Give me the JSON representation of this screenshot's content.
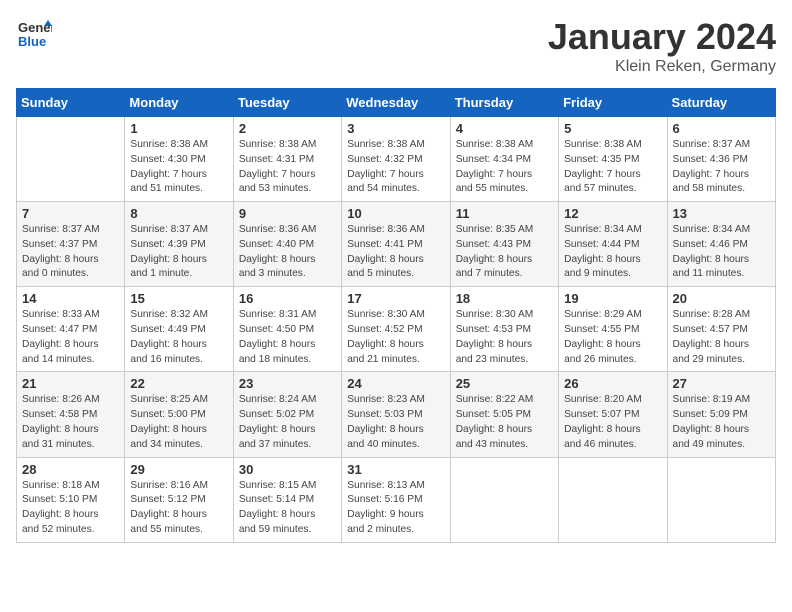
{
  "header": {
    "logo_line1": "General",
    "logo_line2": "Blue",
    "title": "January 2024",
    "subtitle": "Klein Reken, Germany"
  },
  "weekdays": [
    "Sunday",
    "Monday",
    "Tuesday",
    "Wednesday",
    "Thursday",
    "Friday",
    "Saturday"
  ],
  "weeks": [
    [
      {
        "day": "",
        "info": ""
      },
      {
        "day": "1",
        "info": "Sunrise: 8:38 AM\nSunset: 4:30 PM\nDaylight: 7 hours\nand 51 minutes."
      },
      {
        "day": "2",
        "info": "Sunrise: 8:38 AM\nSunset: 4:31 PM\nDaylight: 7 hours\nand 53 minutes."
      },
      {
        "day": "3",
        "info": "Sunrise: 8:38 AM\nSunset: 4:32 PM\nDaylight: 7 hours\nand 54 minutes."
      },
      {
        "day": "4",
        "info": "Sunrise: 8:38 AM\nSunset: 4:34 PM\nDaylight: 7 hours\nand 55 minutes."
      },
      {
        "day": "5",
        "info": "Sunrise: 8:38 AM\nSunset: 4:35 PM\nDaylight: 7 hours\nand 57 minutes."
      },
      {
        "day": "6",
        "info": "Sunrise: 8:37 AM\nSunset: 4:36 PM\nDaylight: 7 hours\nand 58 minutes."
      }
    ],
    [
      {
        "day": "7",
        "info": "Sunrise: 8:37 AM\nSunset: 4:37 PM\nDaylight: 8 hours\nand 0 minutes."
      },
      {
        "day": "8",
        "info": "Sunrise: 8:37 AM\nSunset: 4:39 PM\nDaylight: 8 hours\nand 1 minute."
      },
      {
        "day": "9",
        "info": "Sunrise: 8:36 AM\nSunset: 4:40 PM\nDaylight: 8 hours\nand 3 minutes."
      },
      {
        "day": "10",
        "info": "Sunrise: 8:36 AM\nSunset: 4:41 PM\nDaylight: 8 hours\nand 5 minutes."
      },
      {
        "day": "11",
        "info": "Sunrise: 8:35 AM\nSunset: 4:43 PM\nDaylight: 8 hours\nand 7 minutes."
      },
      {
        "day": "12",
        "info": "Sunrise: 8:34 AM\nSunset: 4:44 PM\nDaylight: 8 hours\nand 9 minutes."
      },
      {
        "day": "13",
        "info": "Sunrise: 8:34 AM\nSunset: 4:46 PM\nDaylight: 8 hours\nand 11 minutes."
      }
    ],
    [
      {
        "day": "14",
        "info": "Sunrise: 8:33 AM\nSunset: 4:47 PM\nDaylight: 8 hours\nand 14 minutes."
      },
      {
        "day": "15",
        "info": "Sunrise: 8:32 AM\nSunset: 4:49 PM\nDaylight: 8 hours\nand 16 minutes."
      },
      {
        "day": "16",
        "info": "Sunrise: 8:31 AM\nSunset: 4:50 PM\nDaylight: 8 hours\nand 18 minutes."
      },
      {
        "day": "17",
        "info": "Sunrise: 8:30 AM\nSunset: 4:52 PM\nDaylight: 8 hours\nand 21 minutes."
      },
      {
        "day": "18",
        "info": "Sunrise: 8:30 AM\nSunset: 4:53 PM\nDaylight: 8 hours\nand 23 minutes."
      },
      {
        "day": "19",
        "info": "Sunrise: 8:29 AM\nSunset: 4:55 PM\nDaylight: 8 hours\nand 26 minutes."
      },
      {
        "day": "20",
        "info": "Sunrise: 8:28 AM\nSunset: 4:57 PM\nDaylight: 8 hours\nand 29 minutes."
      }
    ],
    [
      {
        "day": "21",
        "info": "Sunrise: 8:26 AM\nSunset: 4:58 PM\nDaylight: 8 hours\nand 31 minutes."
      },
      {
        "day": "22",
        "info": "Sunrise: 8:25 AM\nSunset: 5:00 PM\nDaylight: 8 hours\nand 34 minutes."
      },
      {
        "day": "23",
        "info": "Sunrise: 8:24 AM\nSunset: 5:02 PM\nDaylight: 8 hours\nand 37 minutes."
      },
      {
        "day": "24",
        "info": "Sunrise: 8:23 AM\nSunset: 5:03 PM\nDaylight: 8 hours\nand 40 minutes."
      },
      {
        "day": "25",
        "info": "Sunrise: 8:22 AM\nSunset: 5:05 PM\nDaylight: 8 hours\nand 43 minutes."
      },
      {
        "day": "26",
        "info": "Sunrise: 8:20 AM\nSunset: 5:07 PM\nDaylight: 8 hours\nand 46 minutes."
      },
      {
        "day": "27",
        "info": "Sunrise: 8:19 AM\nSunset: 5:09 PM\nDaylight: 8 hours\nand 49 minutes."
      }
    ],
    [
      {
        "day": "28",
        "info": "Sunrise: 8:18 AM\nSunset: 5:10 PM\nDaylight: 8 hours\nand 52 minutes."
      },
      {
        "day": "29",
        "info": "Sunrise: 8:16 AM\nSunset: 5:12 PM\nDaylight: 8 hours\nand 55 minutes."
      },
      {
        "day": "30",
        "info": "Sunrise: 8:15 AM\nSunset: 5:14 PM\nDaylight: 8 hours\nand 59 minutes."
      },
      {
        "day": "31",
        "info": "Sunrise: 8:13 AM\nSunset: 5:16 PM\nDaylight: 9 hours\nand 2 minutes."
      },
      {
        "day": "",
        "info": ""
      },
      {
        "day": "",
        "info": ""
      },
      {
        "day": "",
        "info": ""
      }
    ]
  ]
}
